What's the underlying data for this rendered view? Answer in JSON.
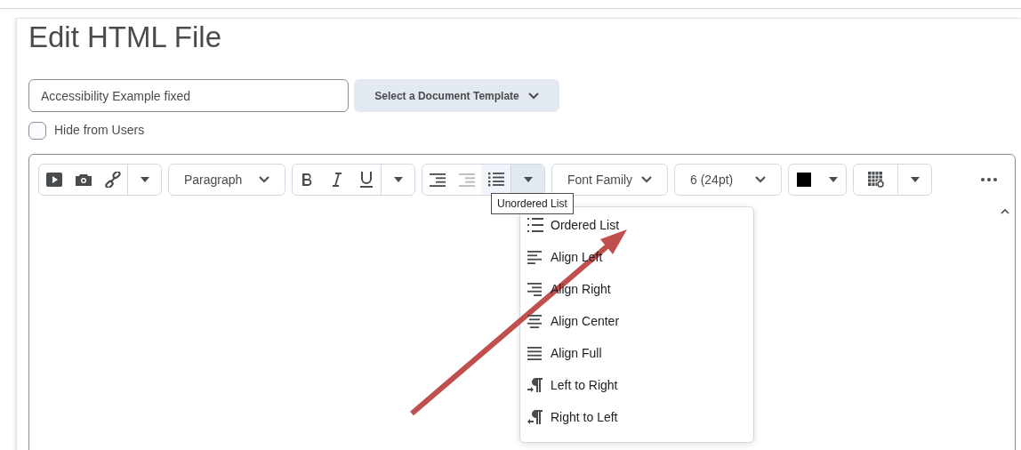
{
  "page_title": "Edit HTML File",
  "title_field": {
    "value": "Accessibility Example fixed"
  },
  "template_button": "Select a Document Template",
  "hide_from_users": {
    "label": "Hide from Users",
    "checked": false
  },
  "toolbar": {
    "paragraph_select": "Paragraph",
    "outdent_disabled": true,
    "list_button_active": true,
    "list_menu_expanded": true,
    "font_family": "Font Family",
    "font_size": "6 (24pt)"
  },
  "tooltip": "Unordered List",
  "list_menu": [
    {
      "kind": "ordered",
      "label": "Ordered List"
    },
    {
      "kind": "left",
      "label": "Align Left"
    },
    {
      "kind": "right",
      "label": "Align Right"
    },
    {
      "kind": "center",
      "label": "Align Center"
    },
    {
      "kind": "full",
      "label": "Align Full"
    },
    {
      "kind": "ltr",
      "label": "Left to Right"
    },
    {
      "kind": "rtl",
      "label": "Right to Left"
    }
  ]
}
